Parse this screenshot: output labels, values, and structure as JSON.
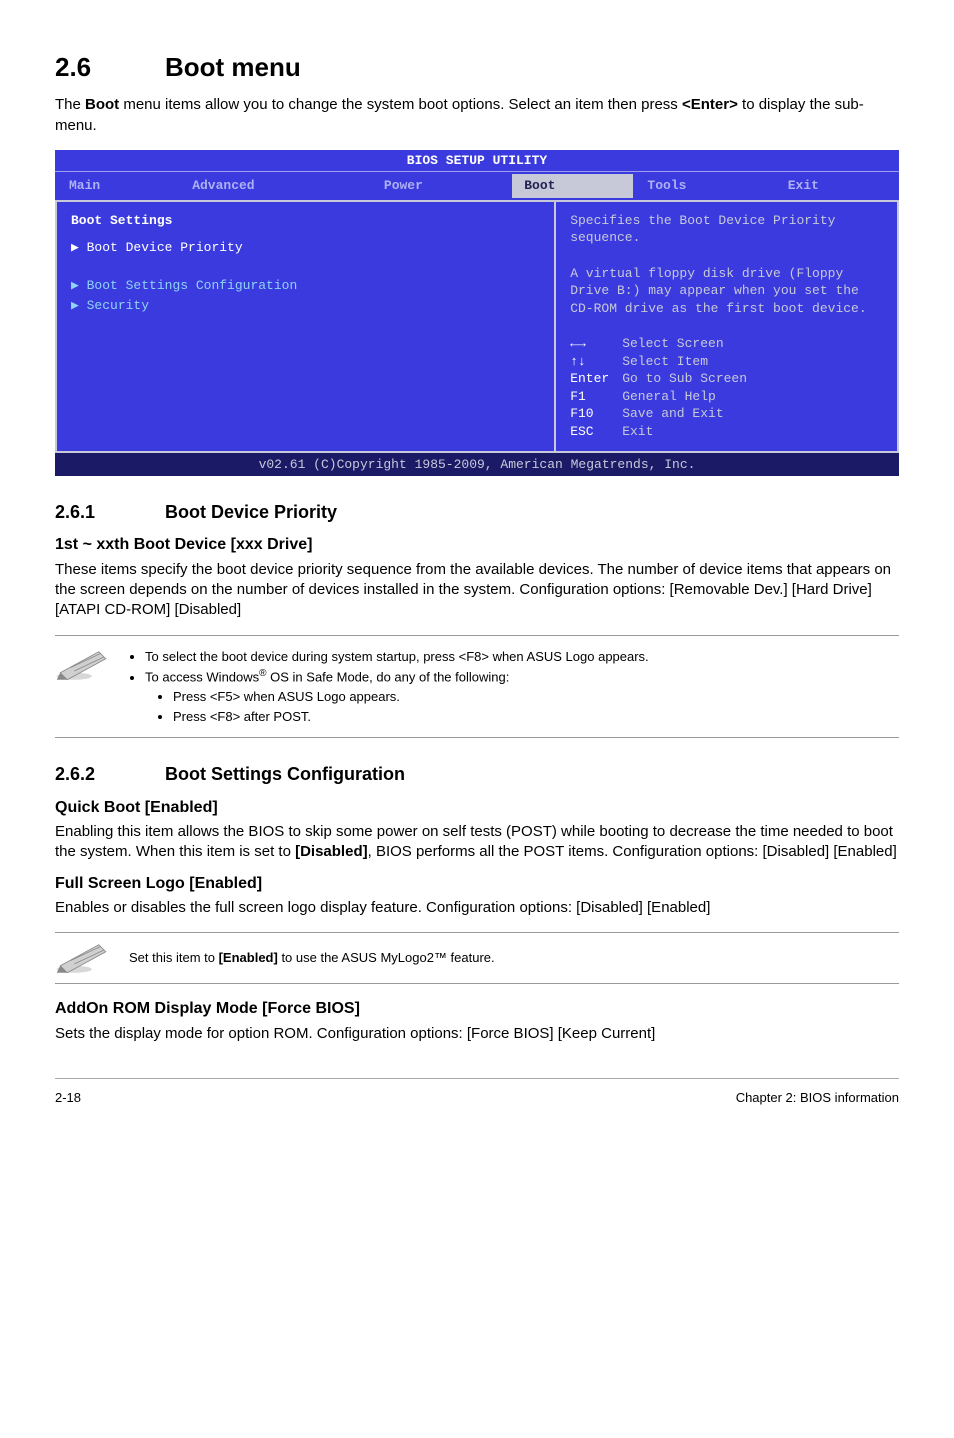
{
  "section": {
    "number": "2.6",
    "title": "Boot menu",
    "intro_pre": "The ",
    "intro_bold1": "Boot",
    "intro_mid": " menu items allow you to change the system boot options. Select an item then press ",
    "intro_bold2": "<Enter>",
    "intro_end": " to display the sub-menu."
  },
  "bios": {
    "title": "BIOS SETUP UTILITY",
    "menu": [
      "Main",
      "Advanced",
      "Power",
      "Boot",
      "Tools",
      "Exit"
    ],
    "menu_selected_index": 3,
    "panel_header": "Boot Settings",
    "items": [
      {
        "label": "Boot Device Priority",
        "selected": true
      },
      {
        "label": "Boot Settings Configuration",
        "selected": false
      },
      {
        "label": "Security",
        "selected": false
      }
    ],
    "help": "Specifies the Boot Device Priority sequence.\n\nA virtual floppy disk drive (Floppy Drive B:) may appear when you set the CD-ROM drive as the first boot device.",
    "keys": [
      {
        "k": "←→",
        "d": "Select Screen"
      },
      {
        "k": "↑↓",
        "d": "Select Item"
      },
      {
        "k": "Enter",
        "d": "Go to Sub Screen"
      },
      {
        "k": "F1",
        "d": "General Help"
      },
      {
        "k": "F10",
        "d": "Save and Exit"
      },
      {
        "k": "ESC",
        "d": "Exit"
      }
    ],
    "footer": "v02.61 (C)Copyright 1985-2009, American Megatrends, Inc."
  },
  "s261": {
    "number": "2.6.1",
    "title": "Boot Device Priority",
    "h3": "1st ~ xxth Boot Device [xxx Drive]",
    "p": "These items specify the boot device priority sequence from the available devices. The number of device items that appears on the screen depends on the number of devices installed in the system. Configuration options: [Removable Dev.] [Hard Drive] [ATAPI CD-ROM] [Disabled]"
  },
  "note1": {
    "l1": "To select the boot device during system startup, press <F8> when ASUS Logo appears.",
    "l2a": "To access Windows",
    "l2sup": "®",
    "l2b": " OS in Safe Mode, do any of the following:",
    "l2_1": "Press <F5> when ASUS Logo appears.",
    "l2_2": "Press <F8> after POST."
  },
  "s262": {
    "number": "2.6.2",
    "title": "Boot Settings Configuration",
    "qb_h": "Quick Boot [Enabled]",
    "qb_p_pre": "Enabling this item allows the BIOS to skip some power on self tests (POST) while booting to decrease the time needed to boot the system. When this item is set to ",
    "qb_p_bold": "[Disabled]",
    "qb_p_post": ", BIOS performs all the POST items. Configuration options: [Disabled] [Enabled]",
    "fs_h": "Full Screen Logo [Enabled]",
    "fs_p": "Enables or disables the full screen logo display feature. Configuration options: [Disabled] [Enabled]"
  },
  "note2": {
    "pre": "Set this item to ",
    "bold": "[Enabled]",
    "post": " to use the ASUS MyLogo2™ feature."
  },
  "addon": {
    "h": "AddOn ROM Display Mode [Force BIOS]",
    "p": "Sets the display mode for option ROM. Configuration options: [Force BIOS] [Keep Current]"
  },
  "footer": {
    "left": "2-18",
    "right": "Chapter 2: BIOS information"
  }
}
